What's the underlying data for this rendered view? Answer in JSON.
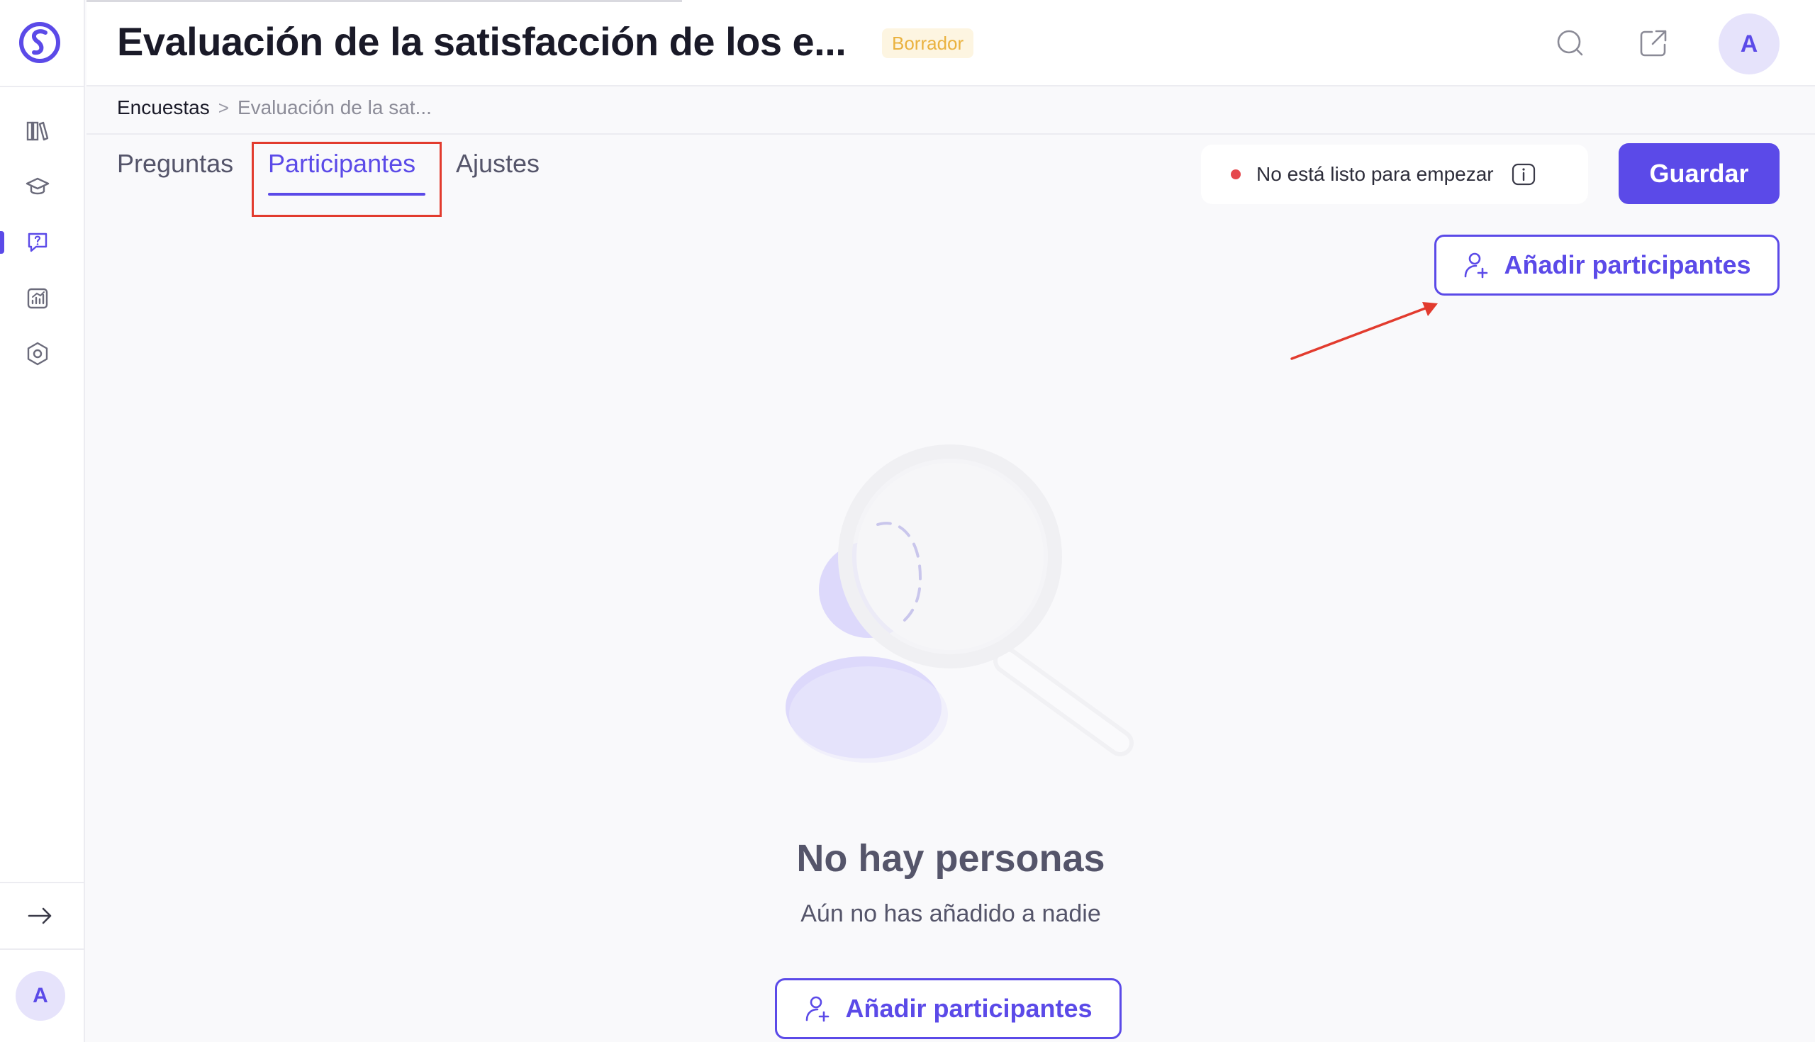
{
  "header": {
    "title": "Evaluación de la satisfacción de los e...",
    "status_badge": "Borrador",
    "avatar_initial": "A"
  },
  "sidebar": {
    "items": [
      {
        "name": "library-icon"
      },
      {
        "name": "graduation-cap-icon"
      },
      {
        "name": "survey-question-icon",
        "active": true
      },
      {
        "name": "analytics-icon"
      },
      {
        "name": "settings-hexagon-icon"
      }
    ],
    "avatar_initial": "A"
  },
  "breadcrumb": {
    "root": "Encuestas",
    "separator": ">",
    "current": "Evaluación de la sat..."
  },
  "tabs": [
    {
      "label": "Preguntas",
      "active": false
    },
    {
      "label": "Participantes",
      "active": true
    },
    {
      "label": "Ajustes",
      "active": false
    }
  ],
  "status": {
    "text": "No está listo para empezar",
    "dot_color": "#e5484d"
  },
  "actions": {
    "save_label": "Guardar",
    "add_participants_label": "Añadir participantes"
  },
  "empty_state": {
    "title": "No hay personas",
    "subtitle": "Aún no has añadido a nadie",
    "button_label": "Añadir participantes"
  },
  "colors": {
    "accent": "#5b4ae8",
    "badge_bg": "#fdf5e1",
    "badge_text": "#eab23f",
    "annotation_red": "#e23b2e"
  }
}
